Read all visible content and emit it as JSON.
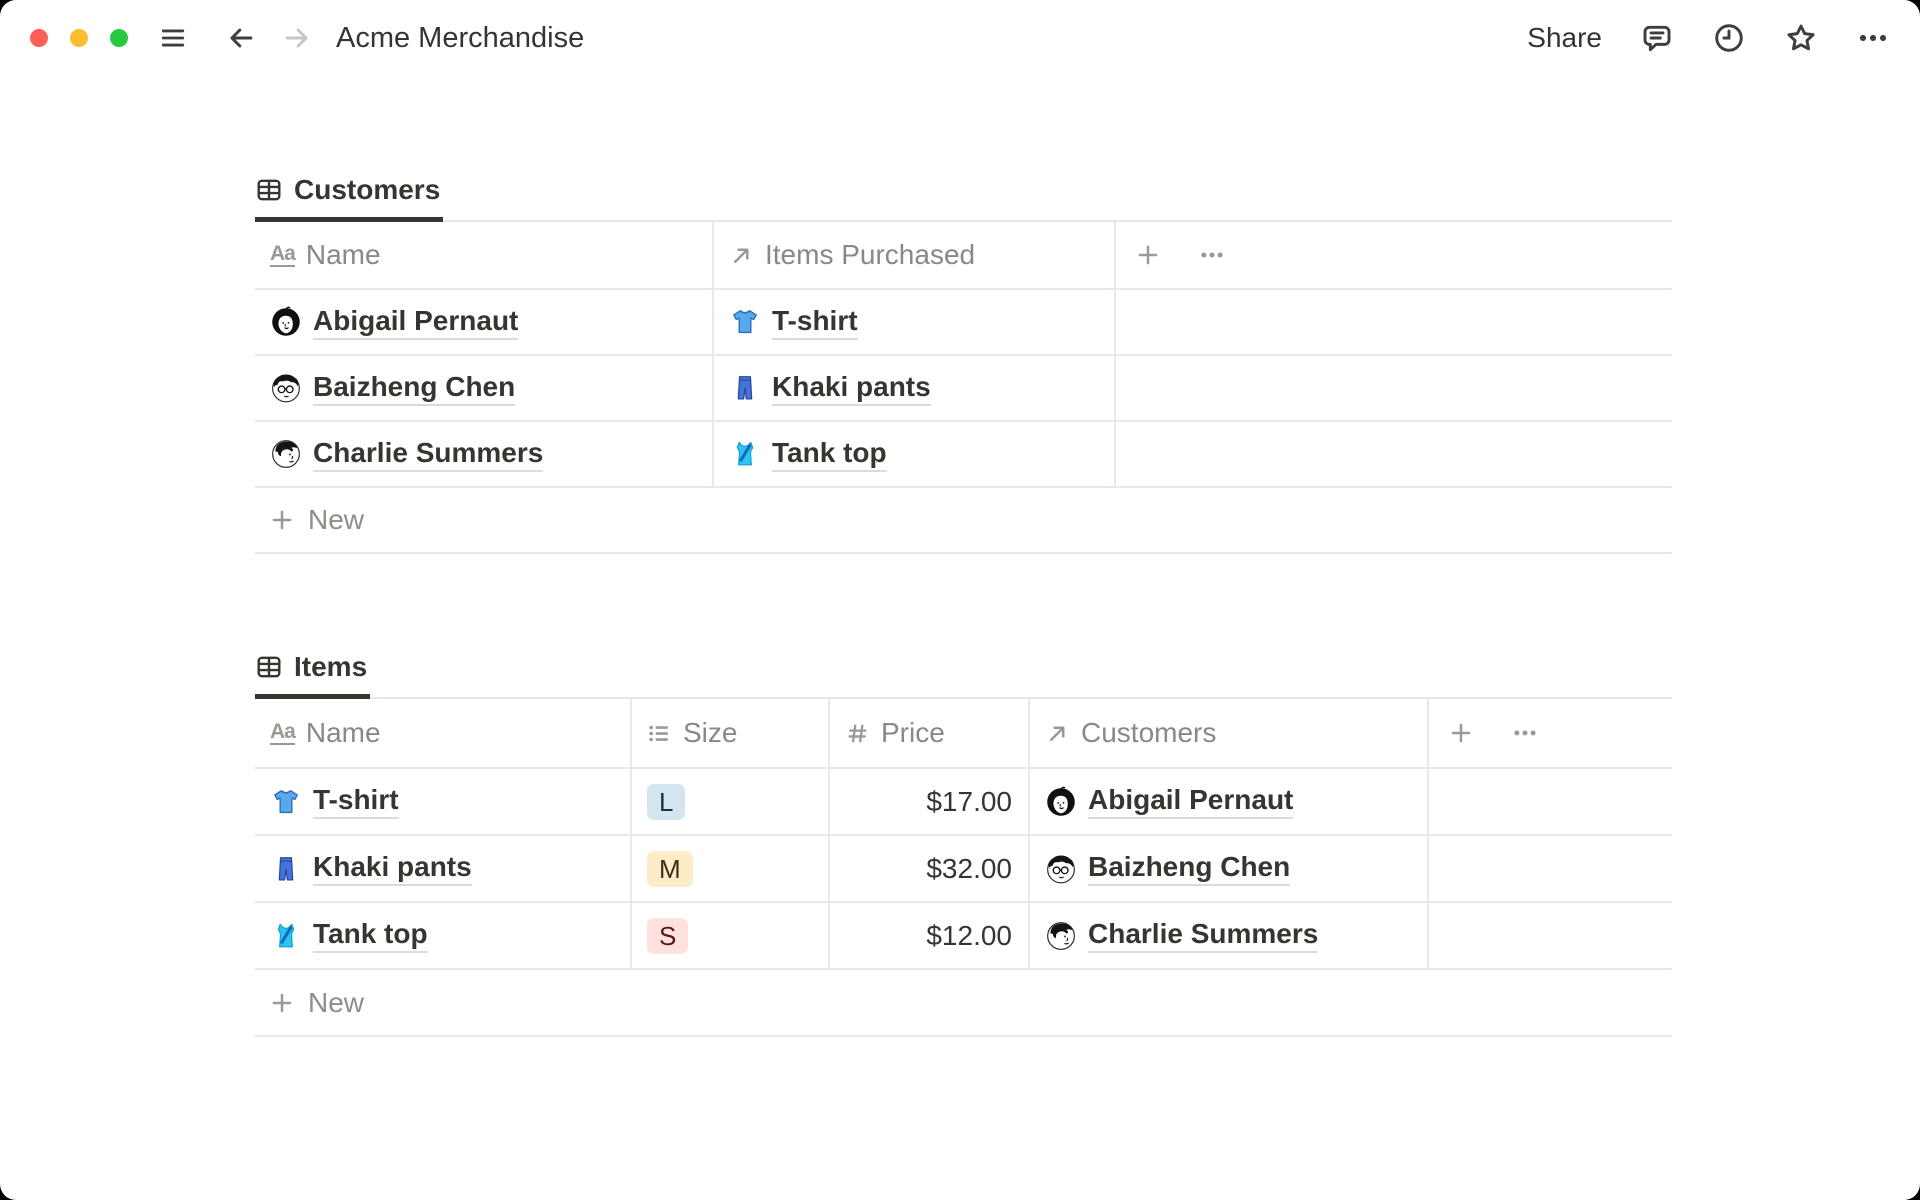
{
  "window": {
    "title": "Acme Merchandise"
  },
  "topbar": {
    "share_label": "Share"
  },
  "icons": {
    "title_glyph": "Aa",
    "toolbar": [
      "comment-icon",
      "history-clock-icon",
      "favorite-star-icon",
      "more-ellipsis-icon"
    ]
  },
  "customers_table": {
    "tab_label": "Customers",
    "columns": [
      {
        "label": "Name",
        "icon": "title-property-icon"
      },
      {
        "label": "Items Purchased",
        "icon": "relation-arrow-icon"
      }
    ],
    "rows": [
      {
        "name": "Abigail Pernaut",
        "avatar": "abigail-avatar",
        "item": "T-shirt",
        "item_icon": "tshirt-icon"
      },
      {
        "name": "Baizheng Chen",
        "avatar": "baizheng-avatar",
        "item": "Khaki pants",
        "item_icon": "jeans-icon"
      },
      {
        "name": "Charlie Summers",
        "avatar": "charlie-avatar",
        "item": "Tank top",
        "item_icon": "tanktop-icon"
      }
    ],
    "new_row_label": "New"
  },
  "items_table": {
    "tab_label": "Items",
    "columns": [
      {
        "label": "Name",
        "icon": "title-property-icon"
      },
      {
        "label": "Size",
        "icon": "select-property-icon"
      },
      {
        "label": "Price",
        "icon": "number-property-icon"
      },
      {
        "label": "Customers",
        "icon": "relation-arrow-icon"
      }
    ],
    "rows": [
      {
        "name": "T-shirt",
        "name_icon": "tshirt-icon",
        "size": "L",
        "size_color": "blue",
        "price": "$17.00",
        "customer": "Abigail Pernaut",
        "customer_avatar": "abigail-avatar"
      },
      {
        "name": "Khaki pants",
        "name_icon": "jeans-icon",
        "size": "M",
        "size_color": "yellow",
        "price": "$32.00",
        "customer": "Baizheng Chen",
        "customer_avatar": "baizheng-avatar"
      },
      {
        "name": "Tank top",
        "name_icon": "tanktop-icon",
        "size": "S",
        "size_color": "red",
        "price": "$12.00",
        "customer": "Charlie Summers",
        "customer_avatar": "charlie-avatar"
      }
    ],
    "new_row_label": "New"
  },
  "colors": {
    "text": "#37352f",
    "secondary_text": "#8a8880",
    "border": "#e9e8e5",
    "tab_underline": "#37352f",
    "traffic_lights": {
      "close": "#ff5f57",
      "minimize": "#febc2e",
      "zoom": "#28c840"
    },
    "badges": {
      "blue": {
        "bg": "#d3e5ef",
        "text": "#183347"
      },
      "yellow": {
        "bg": "#fdecc8",
        "text": "#402c1b"
      },
      "red": {
        "bg": "#ffe2dd",
        "text": "#5d1715"
      }
    }
  }
}
